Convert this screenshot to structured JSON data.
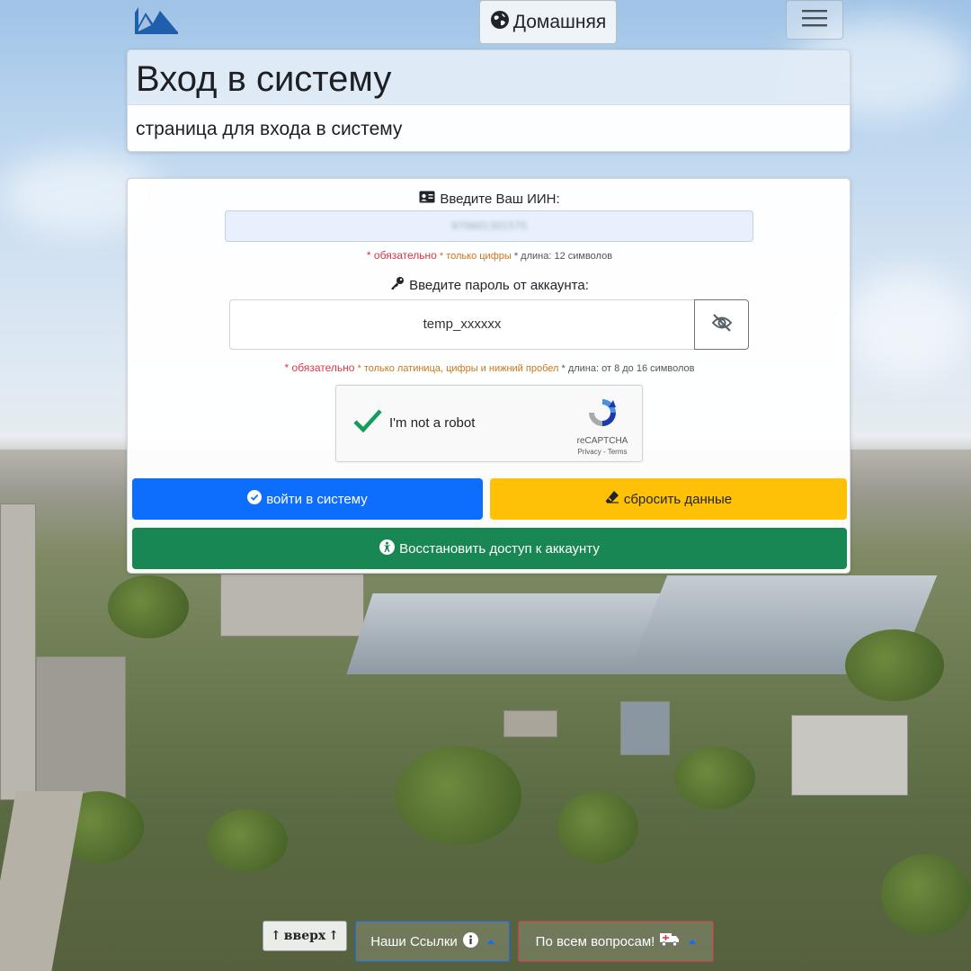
{
  "header": {
    "home_label": "Домашняя",
    "home_icon": "globe-icon",
    "menu_icon": "hamburger-icon"
  },
  "title_card": {
    "title": "Вход в систему",
    "subtitle": "страница для входа в систему"
  },
  "form": {
    "iin": {
      "label": "Введите Ваш ИИН:",
      "icon": "id-card-icon",
      "value": "970601301575",
      "hint_required": "* обязательно",
      "hint_digits": "* только цифры",
      "hint_length": "* длина: 12 символов"
    },
    "password": {
      "label": "Введите пароль от аккаунта:",
      "icon": "key-icon",
      "value": "temp_xxxxxx",
      "toggle_icon": "eye-slash-icon",
      "hint_required": "* обязательно",
      "hint_chars": "* только латиница, цифры и нижний пробел",
      "hint_length": "* длина: от 8 до 16 символов"
    },
    "captcha": {
      "label": "I'm not a robot",
      "brand": "reCAPTCHA",
      "links": "Privacy - Terms"
    },
    "buttons": {
      "login": "войти в систему",
      "reset": "сбросить данные",
      "restore": "Восстановить доступ к аккаунту"
    }
  },
  "footer": {
    "up_label": "вверх",
    "links_label": "Наши Ссылки",
    "ask_label": "По всем вопросам!"
  },
  "colors": {
    "primary": "#0d6efd",
    "warning": "#ffc107",
    "success": "#198754",
    "danger": "#dc3545"
  }
}
